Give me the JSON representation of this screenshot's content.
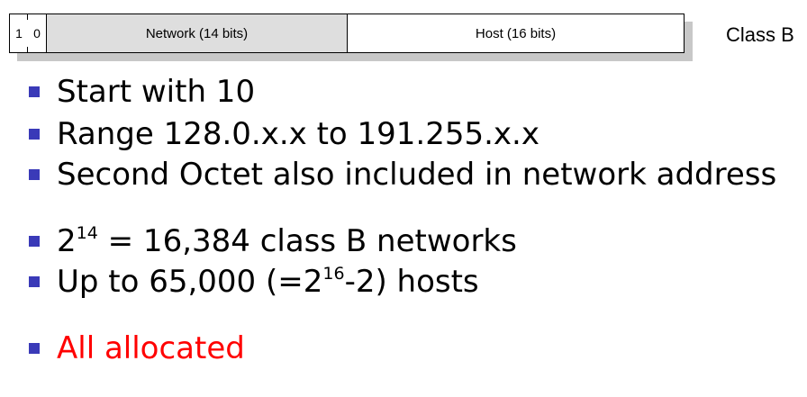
{
  "header_diagram": {
    "bits": [
      "1",
      "0"
    ],
    "network_label": "Network (14 bits)",
    "host_label": "Host (16 bits)",
    "class_label": "Class B"
  },
  "bullets": {
    "b1": "Start with 10",
    "b2": "Range 128.0.x.x to 191.255.x.x",
    "b3": "Second Octet also included in network address",
    "b4": {
      "base": "2",
      "exp": "14",
      "rest": " = 16,384 class B networks"
    },
    "b5": {
      "pre": "Up to 65,000 (=2",
      "exp": "16",
      "post": "-2) hosts"
    },
    "b6": "All allocated"
  },
  "colors": {
    "bullet_marker": "#3a3ab8",
    "highlight_text": "#ff0000",
    "network_field": "#dedede"
  }
}
